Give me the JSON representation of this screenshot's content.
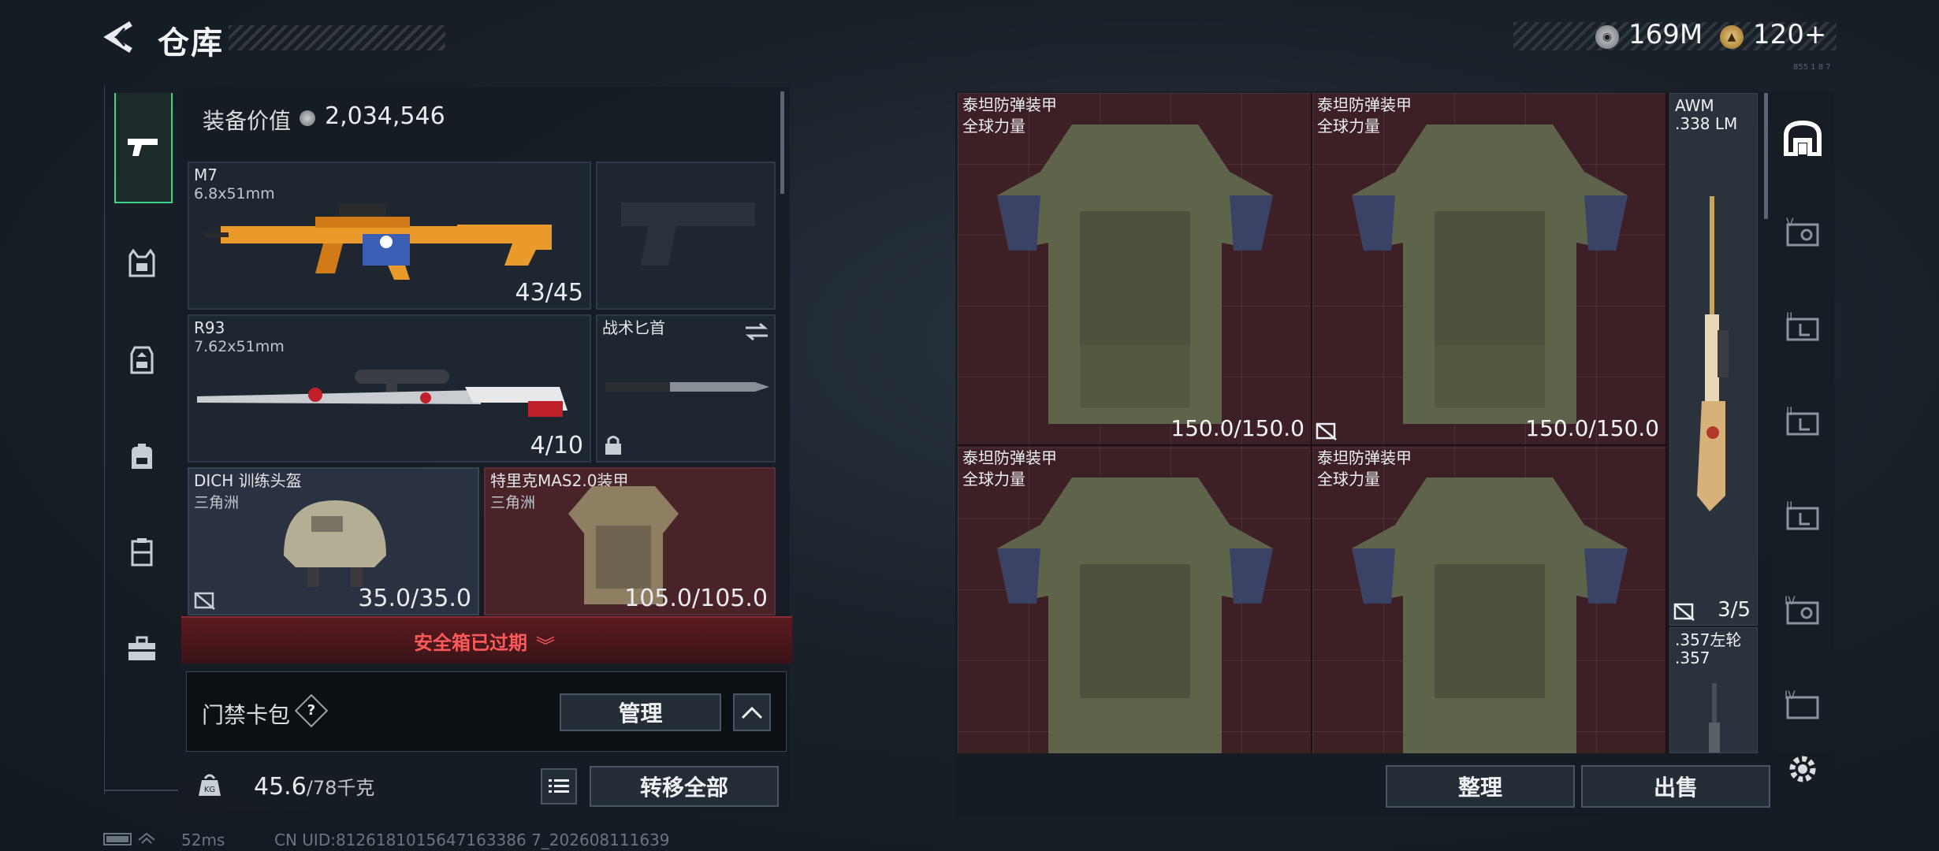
{
  "header": {
    "title": "仓库",
    "currency_1": "169M",
    "currency_2": "120+",
    "tiny_id": "855 1 8 7"
  },
  "nav": {
    "items": [
      {
        "icon": "pistol-icon",
        "active": true
      },
      {
        "icon": "vest-icon"
      },
      {
        "icon": "backpack-rig-icon"
      },
      {
        "icon": "backpack-icon"
      },
      {
        "icon": "locker-icon"
      },
      {
        "icon": "briefcase-icon"
      }
    ]
  },
  "loadout": {
    "value_label": "装备价值",
    "value": "2,034,546",
    "slots": [
      {
        "name": "M7",
        "sub": "6.8x51mm",
        "count": "43/45"
      },
      {
        "name": "",
        "sub": "",
        "count": ""
      },
      {
        "name": "R93",
        "sub": "7.62x51mm",
        "count": "4/10"
      },
      {
        "name": "战术匕首",
        "sub": "",
        "count": ""
      },
      {
        "name": "DICH 训练头盔",
        "sub": "三角洲",
        "count": "35.0/35.0"
      },
      {
        "name": "特里克MAS2.0装甲",
        "sub": "三角洲",
        "count": "105.0/105.0"
      }
    ],
    "banner": "安全箱已过期",
    "keybag_label": "门禁卡包",
    "keybag_help": "?",
    "manage_label": "管理",
    "weight": "45.6",
    "weight_max": "/78千克",
    "transfer_label": "转移全部"
  },
  "stash": {
    "cells": [
      {
        "name": "泰坦防弹装甲",
        "sub": "全球力量",
        "durability": "150.0/150.0"
      },
      {
        "name": "泰坦防弹装甲",
        "sub": "全球力量",
        "durability": "150.0/150.0"
      },
      {
        "name": "泰坦防弹装甲",
        "sub": "全球力量",
        "durability": ""
      },
      {
        "name": "泰坦防弹装甲",
        "sub": "全球力量",
        "durability": ""
      }
    ],
    "awm": {
      "name": "AWM",
      "sub": ".338 LM",
      "count": "3/5"
    },
    "revolver": {
      "name": ".357左轮",
      "sub": ".357"
    },
    "tabs": [
      {
        "label": "V"
      },
      {
        "label": "II"
      },
      {
        "label": "II"
      },
      {
        "label": "II"
      },
      {
        "label": "IV"
      },
      {
        "label": "IV"
      }
    ],
    "sort_label": "整理",
    "sell_label": "出售"
  },
  "status": {
    "ping": "52ms",
    "uid": "CN UID:8126181015647163386 7_202608111639"
  },
  "colors": {
    "accent_green": "#39d38c",
    "warning_red": "#ff5a5a",
    "stash_bg": "#3d1f26"
  }
}
